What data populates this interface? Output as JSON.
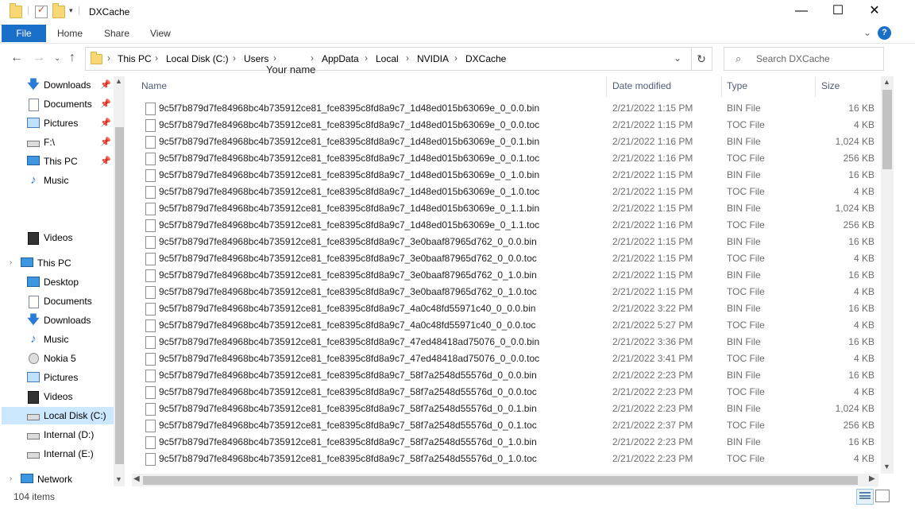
{
  "window": {
    "title": "DXCache",
    "minimize": "—",
    "maximize": "☐",
    "close": "✕"
  },
  "ribbon": {
    "file": "File",
    "tabs": [
      "Home",
      "Share",
      "View"
    ],
    "help": "?"
  },
  "address": {
    "crumbs": [
      "This PC",
      "Local Disk (C:)",
      "Users",
      "",
      "AppData",
      "Local",
      "NVIDIA",
      "DXCache"
    ],
    "overlay_text": "Your name"
  },
  "search": {
    "placeholder": "Search DXCache"
  },
  "sidebar": {
    "quick_access": [
      {
        "label": "Downloads",
        "icon": "download-arrow-icon",
        "pinned": true
      },
      {
        "label": "Documents",
        "icon": "documents-icon",
        "pinned": true
      },
      {
        "label": "Pictures",
        "icon": "pictures-icon",
        "pinned": true
      },
      {
        "label": "F:\\",
        "icon": "drive-icon",
        "pinned": true
      },
      {
        "label": "This PC",
        "icon": "computer-icon",
        "pinned": true
      },
      {
        "label": "Music",
        "icon": "music-icon",
        "pinned": false
      },
      {
        "label": "Videos",
        "icon": "videos-icon",
        "pinned": false
      }
    ],
    "this_pc": {
      "label": "This PC",
      "items": [
        {
          "label": "Desktop",
          "icon": "desktop-icon"
        },
        {
          "label": "Documents",
          "icon": "documents-icon"
        },
        {
          "label": "Downloads",
          "icon": "download-arrow-icon"
        },
        {
          "label": "Music",
          "icon": "music-icon"
        },
        {
          "label": "Nokia 5",
          "icon": "phone-icon"
        },
        {
          "label": "Pictures",
          "icon": "pictures-icon"
        },
        {
          "label": "Videos",
          "icon": "videos-icon"
        },
        {
          "label": "Local Disk (C:)",
          "icon": "system-drive-icon",
          "selected": true
        },
        {
          "label": "Internal (D:)",
          "icon": "drive-icon"
        },
        {
          "label": "Internal (E:)",
          "icon": "drive-icon"
        }
      ]
    },
    "network": "Network"
  },
  "columns": {
    "name": "Name",
    "date": "Date modified",
    "type": "Type",
    "size": "Size"
  },
  "files": [
    {
      "name": "9c5f7b879d7fe84968bc4b735912ce81_fce8395c8fd8a9c7_1d48ed015b63069e_0_0.0.bin",
      "date": "2/21/2022 1:15 PM",
      "type": "BIN File",
      "size": "16 KB"
    },
    {
      "name": "9c5f7b879d7fe84968bc4b735912ce81_fce8395c8fd8a9c7_1d48ed015b63069e_0_0.0.toc",
      "date": "2/21/2022 1:15 PM",
      "type": "TOC File",
      "size": "4 KB"
    },
    {
      "name": "9c5f7b879d7fe84968bc4b735912ce81_fce8395c8fd8a9c7_1d48ed015b63069e_0_0.1.bin",
      "date": "2/21/2022 1:16 PM",
      "type": "BIN File",
      "size": "1,024 KB"
    },
    {
      "name": "9c5f7b879d7fe84968bc4b735912ce81_fce8395c8fd8a9c7_1d48ed015b63069e_0_0.1.toc",
      "date": "2/21/2022 1:16 PM",
      "type": "TOC File",
      "size": "256 KB"
    },
    {
      "name": "9c5f7b879d7fe84968bc4b735912ce81_fce8395c8fd8a9c7_1d48ed015b63069e_0_1.0.bin",
      "date": "2/21/2022 1:15 PM",
      "type": "BIN File",
      "size": "16 KB"
    },
    {
      "name": "9c5f7b879d7fe84968bc4b735912ce81_fce8395c8fd8a9c7_1d48ed015b63069e_0_1.0.toc",
      "date": "2/21/2022 1:15 PM",
      "type": "TOC File",
      "size": "4 KB"
    },
    {
      "name": "9c5f7b879d7fe84968bc4b735912ce81_fce8395c8fd8a9c7_1d48ed015b63069e_0_1.1.bin",
      "date": "2/21/2022 1:15 PM",
      "type": "BIN File",
      "size": "1,024 KB"
    },
    {
      "name": "9c5f7b879d7fe84968bc4b735912ce81_fce8395c8fd8a9c7_1d48ed015b63069e_0_1.1.toc",
      "date": "2/21/2022 1:16 PM",
      "type": "TOC File",
      "size": "256 KB"
    },
    {
      "name": "9c5f7b879d7fe84968bc4b735912ce81_fce8395c8fd8a9c7_3e0baaf87965d762_0_0.0.bin",
      "date": "2/21/2022 1:15 PM",
      "type": "BIN File",
      "size": "16 KB"
    },
    {
      "name": "9c5f7b879d7fe84968bc4b735912ce81_fce8395c8fd8a9c7_3e0baaf87965d762_0_0.0.toc",
      "date": "2/21/2022 1:15 PM",
      "type": "TOC File",
      "size": "4 KB"
    },
    {
      "name": "9c5f7b879d7fe84968bc4b735912ce81_fce8395c8fd8a9c7_3e0baaf87965d762_0_1.0.bin",
      "date": "2/21/2022 1:15 PM",
      "type": "BIN File",
      "size": "16 KB"
    },
    {
      "name": "9c5f7b879d7fe84968bc4b735912ce81_fce8395c8fd8a9c7_3e0baaf87965d762_0_1.0.toc",
      "date": "2/21/2022 1:15 PM",
      "type": "TOC File",
      "size": "4 KB"
    },
    {
      "name": "9c5f7b879d7fe84968bc4b735912ce81_fce8395c8fd8a9c7_4a0c48fd55971c40_0_0.0.bin",
      "date": "2/21/2022 3:22 PM",
      "type": "BIN File",
      "size": "16 KB"
    },
    {
      "name": "9c5f7b879d7fe84968bc4b735912ce81_fce8395c8fd8a9c7_4a0c48fd55971c40_0_0.0.toc",
      "date": "2/21/2022 5:27 PM",
      "type": "TOC File",
      "size": "4 KB"
    },
    {
      "name": "9c5f7b879d7fe84968bc4b735912ce81_fce8395c8fd8a9c7_47ed48418ad75076_0_0.0.bin",
      "date": "2/21/2022 3:36 PM",
      "type": "BIN File",
      "size": "16 KB"
    },
    {
      "name": "9c5f7b879d7fe84968bc4b735912ce81_fce8395c8fd8a9c7_47ed48418ad75076_0_0.0.toc",
      "date": "2/21/2022 3:41 PM",
      "type": "TOC File",
      "size": "4 KB"
    },
    {
      "name": "9c5f7b879d7fe84968bc4b735912ce81_fce8395c8fd8a9c7_58f7a2548d55576d_0_0.0.bin",
      "date": "2/21/2022 2:23 PM",
      "type": "BIN File",
      "size": "16 KB"
    },
    {
      "name": "9c5f7b879d7fe84968bc4b735912ce81_fce8395c8fd8a9c7_58f7a2548d55576d_0_0.0.toc",
      "date": "2/21/2022 2:23 PM",
      "type": "TOC File",
      "size": "4 KB"
    },
    {
      "name": "9c5f7b879d7fe84968bc4b735912ce81_fce8395c8fd8a9c7_58f7a2548d55576d_0_0.1.bin",
      "date": "2/21/2022 2:23 PM",
      "type": "BIN File",
      "size": "1,024 KB"
    },
    {
      "name": "9c5f7b879d7fe84968bc4b735912ce81_fce8395c8fd8a9c7_58f7a2548d55576d_0_0.1.toc",
      "date": "2/21/2022 2:37 PM",
      "type": "TOC File",
      "size": "256 KB"
    },
    {
      "name": "9c5f7b879d7fe84968bc4b735912ce81_fce8395c8fd8a9c7_58f7a2548d55576d_0_1.0.bin",
      "date": "2/21/2022 2:23 PM",
      "type": "BIN File",
      "size": "16 KB"
    },
    {
      "name": "9c5f7b879d7fe84968bc4b735912ce81_fce8395c8fd8a9c7_58f7a2548d55576d_0_1.0.toc",
      "date": "2/21/2022 2:23 PM",
      "type": "TOC File",
      "size": "4 KB"
    }
  ],
  "status": {
    "count": "104 items"
  },
  "colors": {
    "accent": "#1a6fc9",
    "selected": "#cce8ff",
    "folder": "#f8d775"
  }
}
